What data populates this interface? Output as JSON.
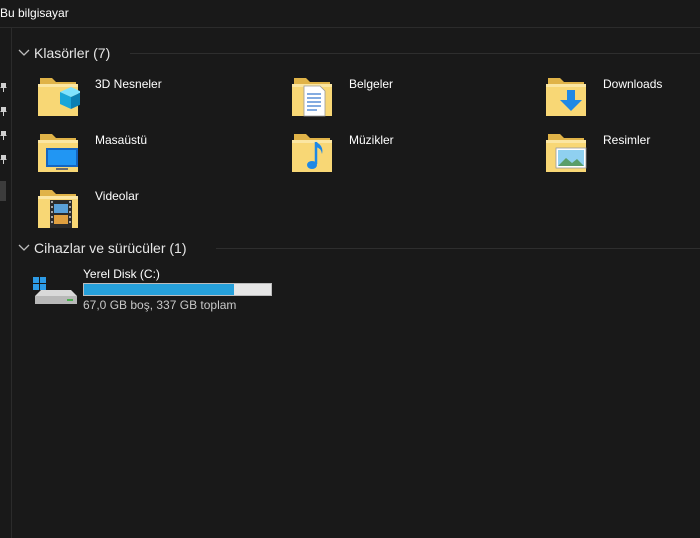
{
  "window": {
    "title": "Bu bilgisayar"
  },
  "groups": {
    "folders": {
      "header": "Klasörler (7)"
    },
    "devices": {
      "header": "Cihazlar ve sürücüler (1)"
    }
  },
  "folders": [
    {
      "label": "3D Nesneler",
      "icon": "3d-objects-folder-icon"
    },
    {
      "label": "Belgeler",
      "icon": "documents-folder-icon"
    },
    {
      "label": "Downloads",
      "icon": "downloads-folder-icon"
    },
    {
      "label": "Masaüstü",
      "icon": "desktop-folder-icon"
    },
    {
      "label": "Müzikler",
      "icon": "music-folder-icon"
    },
    {
      "label": "Resimler",
      "icon": "pictures-folder-icon"
    },
    {
      "label": "Videolar",
      "icon": "videos-folder-icon"
    }
  ],
  "drive": {
    "name": "Yerel Disk (C:)",
    "info": "67,0 GB boş, 337 GB toplam",
    "used_fraction": 0.801,
    "icon": "windows-drive-icon"
  },
  "colors": {
    "background": "#191919",
    "folder": "#f8d775",
    "usage_bar": "#26a0da",
    "usage_track": "#e6e6e6"
  }
}
